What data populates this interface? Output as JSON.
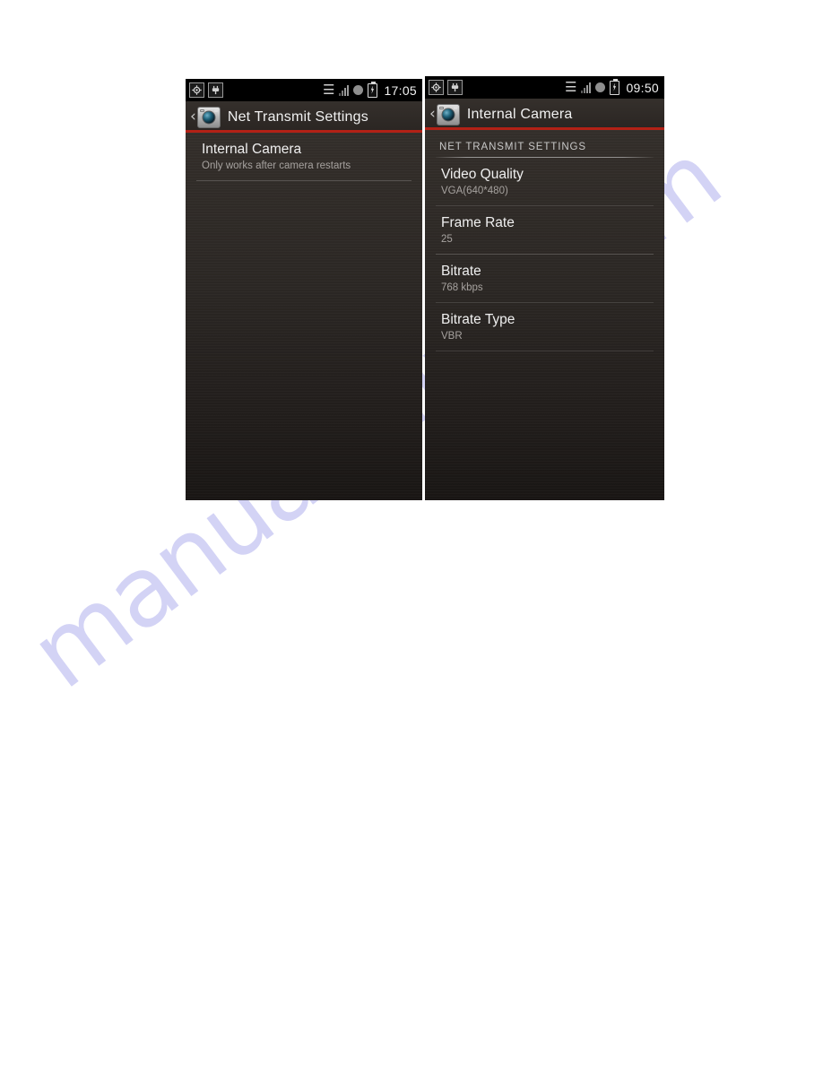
{
  "watermark": {
    "text": "manualshive.com"
  },
  "left_phone": {
    "statusbar": {
      "left_icons": [
        "camera-status-icon",
        "usb-plug-icon"
      ],
      "right_icons": [
        "bluetooth-icon",
        "signal-bars-icon",
        "circle-status-icon",
        "battery-charging-icon"
      ],
      "clock": "17:05"
    },
    "titlebar": {
      "back_label": "‹",
      "app_icon": "camera-app-icon",
      "title": "Net Transmit Settings"
    },
    "items": [
      {
        "title": "Internal Camera",
        "subtitle": "Only works after camera restarts"
      }
    ]
  },
  "right_phone": {
    "statusbar": {
      "left_icons": [
        "camera-status-icon",
        "usb-plug-icon"
      ],
      "right_icons": [
        "bluetooth-icon",
        "signal-bars-icon",
        "circle-status-icon",
        "battery-charging-icon"
      ],
      "clock": "09:50"
    },
    "titlebar": {
      "back_label": "‹",
      "app_icon": "camera-app-icon",
      "title": "Internal Camera"
    },
    "section_header": "NET TRANSMIT SETTINGS",
    "items": [
      {
        "title": "Video Quality",
        "value": "VGA(640*480)"
      },
      {
        "title": "Frame Rate",
        "value": "25"
      },
      {
        "title": "Bitrate",
        "value": "768 kbps"
      },
      {
        "title": "Bitrate Type",
        "value": "VBR"
      }
    ]
  },
  "colors": {
    "accent_red": "#b32116",
    "panel_bg": "#2b2724",
    "statusbar_bg": "#000000",
    "title_text": "#f0f0f0",
    "value_text": "#a6a29f",
    "watermark": "#b9b9ef"
  }
}
